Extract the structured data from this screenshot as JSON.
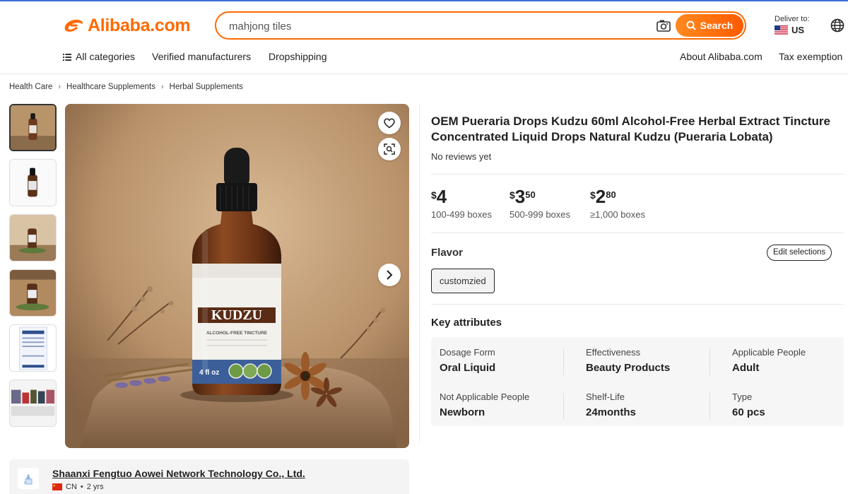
{
  "header": {
    "logo_text": "Alibaba.com",
    "search": {
      "value": "mahjong tiles",
      "button_label": "Search"
    },
    "deliver": {
      "label": "Deliver to:",
      "country": "US"
    }
  },
  "nav": {
    "left": [
      "All categories",
      "Verified manufacturers",
      "Dropshipping"
    ],
    "right": [
      "About Alibaba.com",
      "Tax exemption"
    ]
  },
  "breadcrumb": [
    "Health Care",
    "Healthcare Supplements",
    "Herbal Supplements"
  ],
  "product": {
    "title": "OEM Pueraria Drops Kudzu 60ml Alcohol-Free Herbal Extract Tincture Concentrated Liquid Drops Natural Kudzu (Pueraria Lobata)",
    "reviews": "No reviews yet",
    "label_brand": "KUDZU",
    "label_sub": "ALCOHOL-FREE TINCTURE",
    "label_size": "4 fl oz",
    "prices": [
      {
        "currency": "$",
        "int": "4",
        "dec": "",
        "qty": "100-499 boxes"
      },
      {
        "currency": "$",
        "int": "3",
        "dec": "50",
        "qty": "500-999 boxes"
      },
      {
        "currency": "$",
        "int": "2",
        "dec": "80",
        "qty": "≥1,000 boxes"
      }
    ],
    "flavor": {
      "label": "Flavor",
      "edit_label": "Edit selections",
      "option": "customzied"
    },
    "key_attributes": {
      "title": "Key attributes",
      "items": [
        {
          "label": "Dosage Form",
          "value": "Oral Liquid"
        },
        {
          "label": "Effectiveness",
          "value": "Beauty Products"
        },
        {
          "label": "Applicable People",
          "value": "Adult"
        },
        {
          "label": "Not Applicable People",
          "value": "Newborn"
        },
        {
          "label": "Shelf-Life",
          "value": "24months"
        },
        {
          "label": "Type",
          "value": "60 pcs"
        }
      ]
    }
  },
  "supplier": {
    "name": "Shaanxi Fengtuo Aowei Network Technology Co., Ltd.",
    "country": "CN",
    "years": "2 yrs"
  },
  "colors": {
    "brand": "#ff6a00",
    "text": "#222222"
  }
}
